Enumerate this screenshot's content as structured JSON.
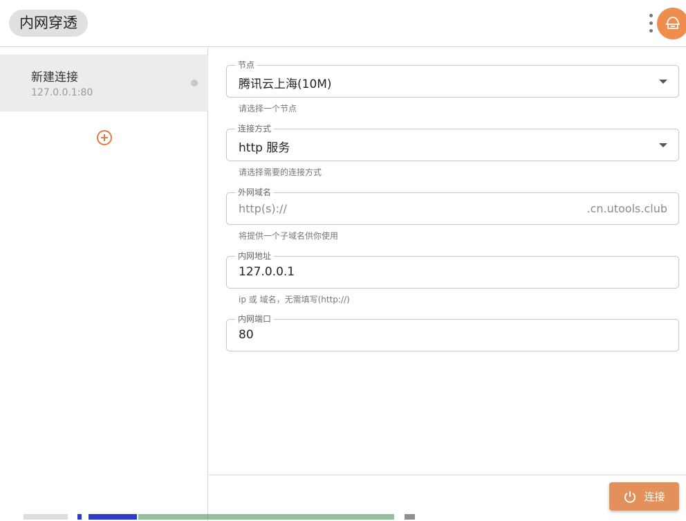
{
  "header": {
    "title": "内网穿透",
    "menu_icon": "more-vert-icon",
    "avatar_icon": "tunnel-app-icon"
  },
  "sidebar": {
    "connections": [
      {
        "name": "新建连接",
        "address": "127.0.0.1:80",
        "status_color": "#c8c8c8"
      }
    ],
    "add_icon": "add-circle-icon"
  },
  "form": {
    "node": {
      "label": "节点",
      "value": "腾讯云上海(10M)",
      "hint": "请选择一个节点"
    },
    "connect_type": {
      "label": "连接方式",
      "value": "http 服务",
      "hint": "请选择需要的连接方式"
    },
    "domain": {
      "label": "外网域名",
      "prefix": "http(s)://",
      "suffix": ".cn.utools.club",
      "value": "",
      "hint": "将提供一个子域名供你使用"
    },
    "local_host": {
      "label": "内网地址",
      "value": "127.0.0.1",
      "hint": "ip 或 域名，无需填写(http://)"
    },
    "local_port": {
      "label": "内网端口",
      "value": "80"
    }
  },
  "footer": {
    "connect_label": "连接",
    "connect_icon": "power-icon"
  },
  "colors": {
    "accent": "#e4905a",
    "avatar": "#ef8d4e",
    "add_icon": "#e07b3c"
  }
}
